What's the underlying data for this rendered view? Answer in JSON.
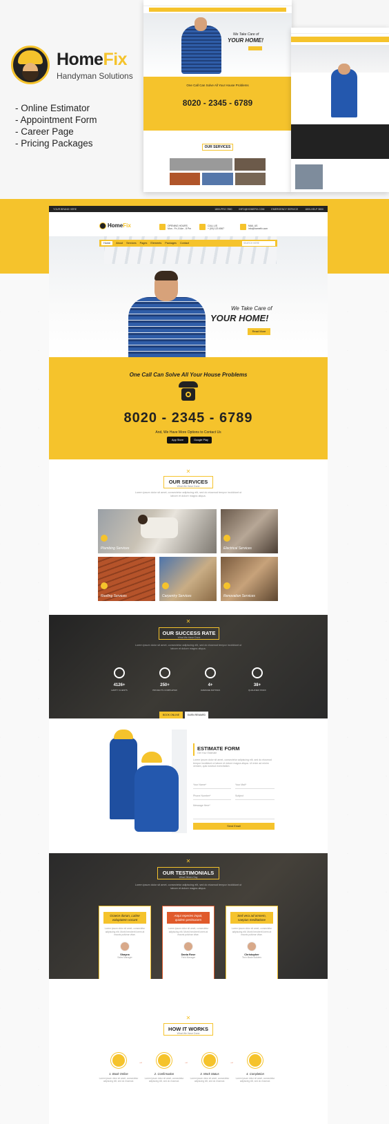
{
  "brand": {
    "name_part1": "Home",
    "name_part2": "Fix",
    "tagline": "Handyman Solutions",
    "accent": "#f5c32c"
  },
  "features": [
    "- Online Estimator",
    "- Appointment Form",
    "- Career Page",
    "- Pricing Packages"
  ],
  "mockup": {
    "topbar": {
      "left": "YOUR BRAND HERE",
      "items": [
        "1800-PRO 7890",
        "INFO@HOMEFIX.COM",
        "EMERGENCY SERVICE",
        "1800-HELP 3800"
      ]
    },
    "header": {
      "logo_part1": "Home",
      "logo_part2": "Fix",
      "info": [
        {
          "icon": "clock-icon",
          "line1": "OPENING HOURS",
          "line2": "Mon - Fri, 8 Am - 8 Pm"
        },
        {
          "icon": "phone-icon",
          "line1": "CALL US",
          "line2": "+ (00) 123 4567"
        },
        {
          "icon": "mail-icon",
          "line1": "MAIL US",
          "line2": "info@homefix.com"
        }
      ]
    },
    "nav": {
      "items": [
        "Home",
        "About",
        "Services",
        "Pages",
        "Elements",
        "Packages",
        "Contact"
      ],
      "search_placeholder": "SEARCH HERE"
    },
    "hero": {
      "subtitle": "We Take Care of",
      "title": "YOUR HOME!",
      "button": "Read More"
    },
    "call": {
      "title": "One Call Can Solve All Your House Problems",
      "number": "8020 - 2345 - 6789",
      "sub": "And, We Have More Options to Contact Us",
      "app_store": "App Store",
      "google_play": "Google Play"
    },
    "services": {
      "title": "OUR SERVICES",
      "subtitle": "What We Have Done",
      "desc": "Lorem ipsum dolor sit amet, consectetur adipiscing elit, sed do eiusmod tempor incididunt ut labore et dolore magna aliqua.",
      "items": [
        "Plumbing Services",
        "Electrical Services",
        "Roofing Services",
        "Carpentry Services",
        "Renovation Services"
      ]
    },
    "success": {
      "title": "OUR SUCCESS RATE",
      "subtitle": "What We Have Done",
      "desc": "Lorem ipsum dolor sit amet, consectetur adipiscing elit, sed do eiusmod tempor incididunt ut labore et dolore magna aliqua.",
      "stats": [
        {
          "value": "4126+",
          "label": "HAPPY CLIENTS",
          "icon": "team-icon"
        },
        {
          "value": "250+",
          "label": "PROJECTS COMPLETED",
          "icon": "worker-icon"
        },
        {
          "value": "4+",
          "label": "AVERAGE RATINGS",
          "icon": "globe-icon"
        },
        {
          "value": "38+",
          "label": "QUALIFIED STAFF",
          "icon": "person-icon"
        }
      ],
      "tabs": [
        "BOOK ONLINE",
        "EARN REWARD"
      ]
    },
    "estimate": {
      "title": "ESTIMATE FORM",
      "subtitle": "Get Your Estimate",
      "desc": "Lorem ipsum dolor sit amet, consectetur adipiscing elit, sed do eiusmod tempor incididunt ut labore et dolore magna aliqua. Ut enim ad minim veniam, quis nostrud exercitation.",
      "fields": [
        "Your Name*",
        "Your Mail*",
        "Phone Number*",
        "Subject"
      ],
      "message": "Message Here*",
      "button": "Send Email"
    },
    "testimonials": {
      "title": "OUR TESTIMONIALS",
      "subtitle": "What Others Say",
      "desc": "Lorem ipsum dolor sit amet, consectetur adipiscing elit, sed do eiusmod tempor incididunt ut labore et dolore magna aliqua.",
      "cards": [
        {
          "quote": "Graece donan, Latine voluptatem vocant",
          "body": "Lorem ipsum dolor sit amet, consectetur adipiscing elit. Morbi hendrerit lorem at mauris pulvinar vitae.",
          "name": "Shayna",
          "role": "Sales Manager"
        },
        {
          "quote": "Atqui reperies inquit, quidem pertinacem",
          "body": "Lorem ipsum dolor sit amet, consectetur adipiscing elit. Morbi hendrerit lorem at mauris pulvinar vitae.",
          "name": "Dania Rose",
          "role": "Field Manager"
        },
        {
          "quote": "Sed vera ad omnem, saepius meditatione",
          "body": "Lorem ipsum dolor sit amet, consectetur adipiscing elit. Morbi hendrerit lorem at mauris pulvinar vitae.",
          "name": "Christopher",
          "role": "Tech Made Builders"
        }
      ]
    },
    "how": {
      "title": "HOW IT WORKS",
      "subtitle": "What We Have Done",
      "steps": [
        {
          "title": "1. Book Online",
          "desc": "Lorem ipsum dolor sit amet, consectetur adipiscing elit, sed do eiusmod."
        },
        {
          "title": "2. Confirmation",
          "desc": "Lorem ipsum dolor sit amet, consectetur adipiscing elit, sed do eiusmod."
        },
        {
          "title": "3. Work Status",
          "desc": "Lorem ipsum dolor sit amet, consectetur adipiscing elit, sed do eiusmod."
        },
        {
          "title": "4. Completion",
          "desc": "Lorem ipsum dolor sit amet, consectetur adipiscing elit, sed do eiusmod."
        }
      ]
    }
  },
  "thumb1": {
    "slogan": "We Take Care of",
    "title": "YOUR HOME!",
    "call_title": "One Call Can Solve All Your House Problems",
    "number": "8020 - 2345 - 6789",
    "services": "OUR SERVICES"
  }
}
